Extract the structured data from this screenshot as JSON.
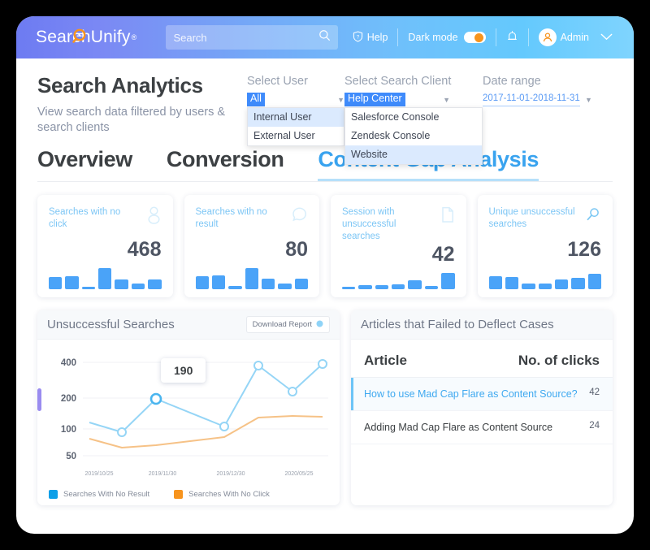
{
  "brand": {
    "name": "SearchUnify",
    "trademark": "®",
    "logo_icon": "magnifier-logo-icon"
  },
  "topbar": {
    "search": {
      "placeholder": "Search",
      "value": "",
      "icon": "search-icon"
    },
    "help": {
      "label": "Help",
      "icon": "help-shield-icon"
    },
    "dark_mode": {
      "label": "Dark mode",
      "state": "on",
      "accent": "#f7941e"
    },
    "notifications": {
      "icon": "bell-icon"
    },
    "user": {
      "label": "Admin",
      "avatar_icon": "user-avatar-icon",
      "caret": "chevron-down-icon"
    }
  },
  "page": {
    "title": "Search Analytics",
    "subtitle": "View search data filtered by users & search clients"
  },
  "filters": {
    "user": {
      "label": "Select User",
      "selected": "All",
      "options": [
        "Internal User",
        "External User"
      ],
      "hovered_option": "Internal User",
      "caret": "caret-down-icon"
    },
    "search_client": {
      "label": "Select Search Client",
      "selected": "Help Center",
      "options": [
        "Salesforce Console",
        "Zendesk Console",
        "Website"
      ],
      "hovered_option": "Website",
      "caret": "caret-down-icon"
    },
    "date_range": {
      "label": "Date range",
      "value": "2017-11-01-2018-11-31",
      "caret": "caret-down-icon"
    }
  },
  "tabs": [
    {
      "label": "Overview",
      "active": false
    },
    {
      "label": "Conversion",
      "active": false
    },
    {
      "label": "Content Gap Analysis",
      "active": true
    }
  ],
  "stat_cards": [
    {
      "label": "Searches with no click",
      "value": "468",
      "icon": "person-icon",
      "spark": [
        58,
        62,
        10,
        100,
        46,
        24,
        46
      ]
    },
    {
      "label": "Searches with no result",
      "value": "80",
      "icon": "comment-bubble-icon",
      "spark": [
        60,
        64,
        14,
        100,
        48,
        26,
        48
      ]
    },
    {
      "label": "Session with unsuccessful searches",
      "value": "42",
      "icon": "document-icon",
      "spark": [
        12,
        22,
        22,
        26,
        55,
        18,
        100
      ]
    },
    {
      "label": "Unique unsuccessful searches",
      "value": "126",
      "icon": "search-stat-icon",
      "spark": [
        60,
        58,
        26,
        26,
        44,
        52,
        72
      ]
    }
  ],
  "unsuccessful_panel": {
    "title": "Unsuccessful Searches",
    "download_label": "Download Report",
    "download_icon": "download-icon",
    "tooltip_value": "190"
  },
  "articles_panel": {
    "title": "Articles that Failed to Deflect Cases",
    "columns": [
      "Article",
      "No. of clicks"
    ],
    "rows": [
      {
        "title": "How to use Mad Cap Flare as Content Source?",
        "clicks": "42",
        "highlighted": true
      },
      {
        "title": "Adding Mad Cap Flare as Content Source",
        "clicks": "24",
        "highlighted": false
      }
    ]
  },
  "chart_data": {
    "type": "line",
    "title": "Unsuccessful Searches",
    "xlabel": "",
    "ylabel": "",
    "grid": true,
    "legend_position": "bottom",
    "ylim": [
      40,
      450
    ],
    "yticks": [
      "400",
      "200",
      "100",
      "50"
    ],
    "x": [
      "2019/10/25",
      "2019/11/30",
      "2019/12/30",
      "2020/05/25"
    ],
    "xticks": [
      "2019/10/25",
      "2019/11/30",
      "2019/12/30",
      "2020/05/25"
    ],
    "series": [
      {
        "name": "Searches With No Result",
        "color": "#0c9fe8",
        "values": [
          125,
          95,
          190,
          110,
          380,
          215,
          390
        ]
      },
      {
        "name": "Searches With No Click",
        "color": "#f7941e",
        "values": [
          78,
          63,
          68,
          74,
          82,
          122,
          120
        ]
      }
    ],
    "annotations": [
      {
        "text": "190",
        "series": "Searches With No Result",
        "index": 2
      }
    ]
  }
}
